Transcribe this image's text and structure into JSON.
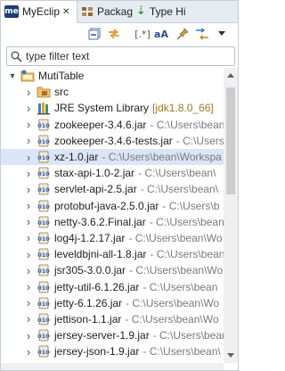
{
  "tabs": [
    {
      "label": "MyEclip",
      "icon": "me-icon",
      "active": true
    },
    {
      "label": "Packag",
      "icon": "package-icon",
      "active": false
    },
    {
      "label": "Type Hi",
      "icon": "type-hierarchy-icon",
      "active": false
    }
  ],
  "close_glyph": "✕",
  "toolbar": {
    "items": [
      "collapse-all-icon",
      "link-with-editor-icon",
      "filter-icon",
      "sort-alpha-icon",
      "pin-icon",
      "view-menu-icon"
    ],
    "filter_glyph": "[.*]",
    "alpha_glyph": "aA"
  },
  "filter": {
    "placeholder": "type filter text"
  },
  "tree": {
    "root": {
      "label": "MutiTable",
      "expanded": true
    },
    "children": [
      {
        "label": "src",
        "path": "",
        "icon": "source-folder-icon"
      },
      {
        "label": "JRE System Library",
        "path": "[jdk1.8.0_66]",
        "icon": "library-icon"
      },
      {
        "label": "zookeeper-3.4.6.jar",
        "path": "- C:\\Users\\bean",
        "icon": "jar-icon"
      },
      {
        "label": "zookeeper-3.4.6-tests.jar",
        "path": "- C:\\Users\\bea",
        "icon": "jar-icon"
      },
      {
        "label": "xz-1.0.jar",
        "path": "- C:\\Users\\bean\\Workspa",
        "icon": "jar-icon",
        "selected": true
      },
      {
        "label": "stax-api-1.0-2.jar",
        "path": "- C:\\Users\\bean\\",
        "icon": "jar-icon"
      },
      {
        "label": "servlet-api-2.5.jar",
        "path": "- C:\\Users\\bean\\",
        "icon": "jar-icon"
      },
      {
        "label": "protobuf-java-2.5.0.jar",
        "path": "- C:\\Users\\b",
        "icon": "jar-icon"
      },
      {
        "label": "netty-3.6.2.Final.jar",
        "path": "- C:\\Users\\bean",
        "icon": "jar-icon"
      },
      {
        "label": "log4j-1.2.17.jar",
        "path": "- C:\\Users\\bean\\Wo",
        "icon": "jar-icon"
      },
      {
        "label": "leveldbjni-all-1.8.jar",
        "path": "- C:\\Users\\bean",
        "icon": "jar-icon"
      },
      {
        "label": "jsr305-3.0.0.jar",
        "path": "- C:\\Users\\bean\\Wo",
        "icon": "jar-icon"
      },
      {
        "label": "jetty-util-6.1.26.jar",
        "path": "- C:\\Users\\bean",
        "icon": "jar-icon"
      },
      {
        "label": "jetty-6.1.26.jar",
        "path": "- C:\\Users\\bean\\Wo",
        "icon": "jar-icon"
      },
      {
        "label": "jettison-1.1.jar",
        "path": "- C:\\Users\\bean\\Wo",
        "icon": "jar-icon"
      },
      {
        "label": "jersey-server-1.9.jar",
        "path": "- C:\\Users\\bean",
        "icon": "jar-icon"
      },
      {
        "label": "jersey-json-1.9.jar",
        "path": "- C:\\Users\\bean\\",
        "icon": "jar-icon"
      }
    ]
  },
  "colors": {
    "tab_bar_bg": "#e6ebf2",
    "selection_bg": "#dae6f6",
    "path_text": "#7a7a7a",
    "jdk_text": "#9b7a2a"
  }
}
